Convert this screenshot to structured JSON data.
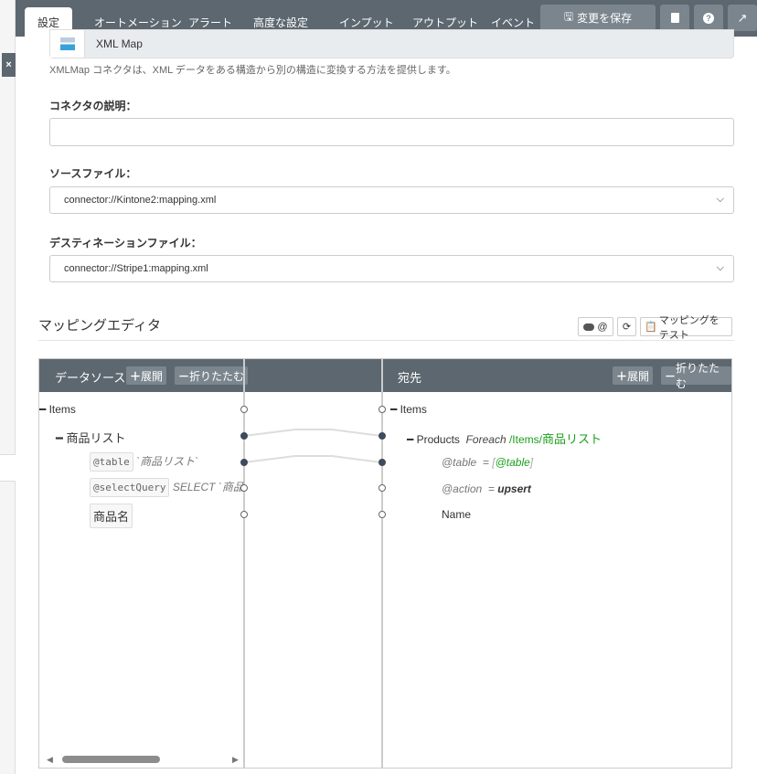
{
  "tabs": [
    "設定",
    "オートメーション",
    "アラート",
    "高度な設定",
    "インプット",
    "アウトプット",
    "イベント"
  ],
  "toolbar": {
    "save": "変更を保存",
    "close": "×"
  },
  "connector": {
    "name": "XML Map",
    "description": "XMLMap コネクタは、XML データをある構造から別の構造に変換する方法を提供します。"
  },
  "form": {
    "desc_label": "コネクタの説明：",
    "desc_value": "",
    "source_label": "ソースファイル：",
    "source_value": "connector://Kintone2:mapping.xml",
    "dest_label": "デスティネーションファイル：",
    "dest_value": "connector://Stripe1:mapping.xml"
  },
  "editor": {
    "title": "マッピングエディタ",
    "at_toggle": "@",
    "test": "マッピングをテスト",
    "source_header": "データソース",
    "dest_header": "宛先",
    "expand": "展開",
    "collapse": "折りたたむ",
    "source": {
      "items": "Items",
      "list": "商品リスト",
      "table_attr": "@table",
      "table_val": "`商品リスト`",
      "query_attr": "@selectQuery",
      "query_val": "SELECT `商品",
      "name": "商品名"
    },
    "dest": {
      "items": "Items",
      "products": "Products",
      "foreach": "Foreach",
      "path_a": "/Items/",
      "path_b": "商品リスト",
      "table_attr": "@table",
      "eq": "=",
      "table_b1": "[",
      "table_val": "@table",
      "table_b2": "]",
      "action_attr": "@action",
      "action_val": "upsert",
      "name": "Name"
    },
    "mappings": [
      [
        "list",
        "products"
      ],
      [
        "table",
        "table"
      ]
    ]
  },
  "colors": {
    "header": "#5c6770",
    "accent": "#1a9f1a",
    "node": "#3d4b5c"
  }
}
